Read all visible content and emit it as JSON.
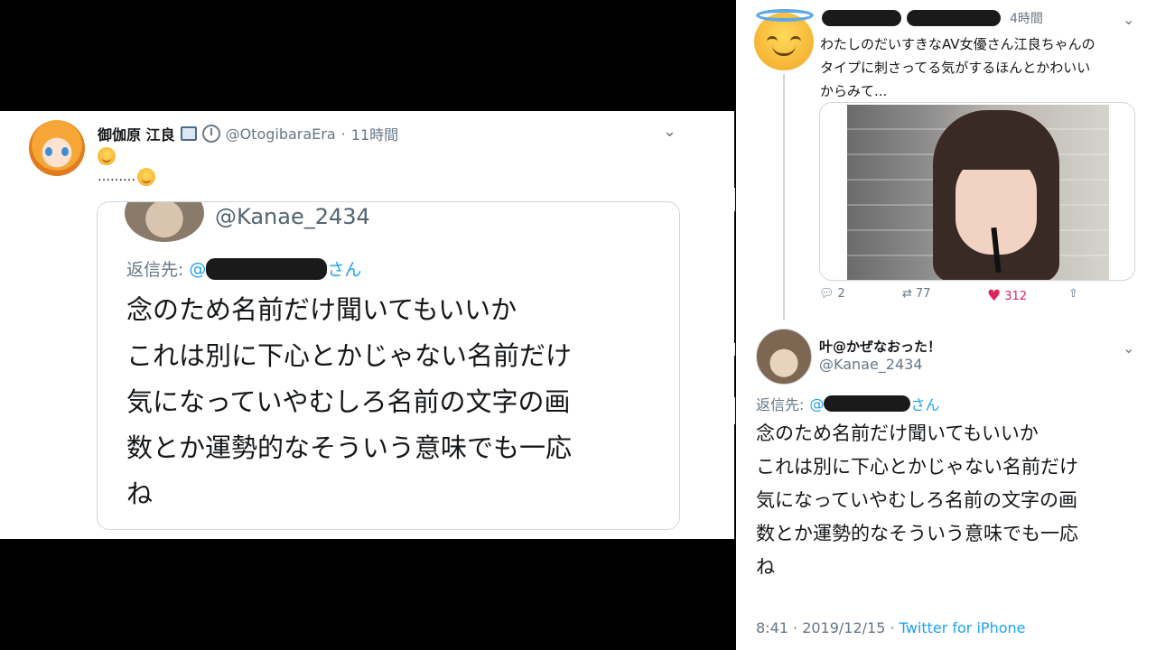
{
  "left_tweet": {
    "author_name": "御伽原 江良",
    "handle": "@OtogibaraEra",
    "dot": "·",
    "time": "11時間",
    "line2_text": "………",
    "quote": {
      "handle": "@Kanae_2434",
      "reply_prefix": "返信先:",
      "reply_at": "@",
      "reply_suffix": "さん",
      "lines": [
        "念のため名前だけ聞いてもいいか",
        "これは別に下心とかじゃない名前だけ",
        "気になっていやむしろ名前の文字の画",
        "数とか運勢的なそういう意味でも一応",
        "ね"
      ]
    }
  },
  "right_thread": {
    "top_tweet": {
      "time": "4時間",
      "lines": [
        "わたしのだいすきなAV女優さん江良ちゃんの",
        "タイプに刺さってる気がするほんとかわいい",
        "からみて..."
      ],
      "reply_count": "2",
      "retweet_count": "77",
      "like_count": "312"
    },
    "reply_tweet": {
      "author_name": "叶@かぜなおった！",
      "handle": "@Kanae_2434",
      "reply_prefix": "返信先:",
      "reply_at": "@",
      "reply_suffix": "さん",
      "lines": [
        "念のため名前だけ聞いてもいいか",
        "これは別に下心とかじゃない名前だけ",
        "気になっていやむしろ名前の文字の画",
        "数とか運勢的なそういう意味でも一応",
        "ね"
      ],
      "timestamp": "8:41 · 2019/12/15 · ",
      "client": "Twitter for iPhone"
    }
  },
  "colors": {
    "link": "#1da1f2",
    "like": "#e0245e",
    "muted": "#657786"
  },
  "icons": [
    "chevron-down-icon",
    "reply-icon",
    "retweet-icon",
    "heart-icon",
    "share-icon",
    "clock-icon",
    "badge-icon"
  ]
}
